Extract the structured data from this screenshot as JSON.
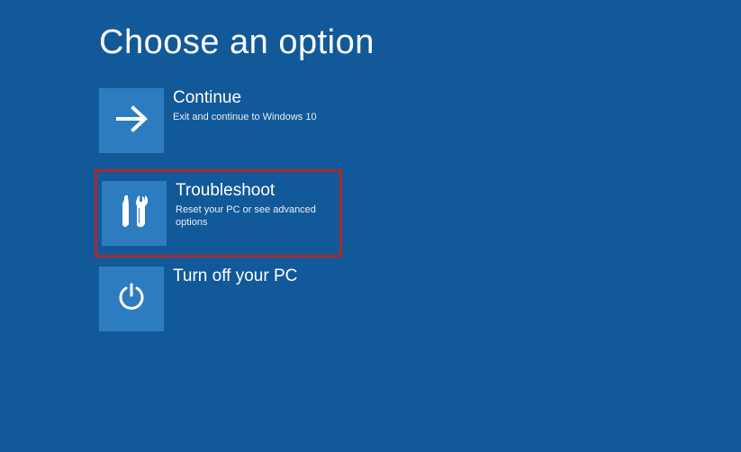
{
  "title": "Choose an option",
  "options": {
    "continue": {
      "title": "Continue",
      "subtitle": "Exit and continue to Windows 10"
    },
    "troubleshoot": {
      "title": "Troubleshoot",
      "subtitle": "Reset your PC or see advanced options"
    },
    "turnoff": {
      "title": "Turn off your PC"
    }
  },
  "highlight_color": "#a82a2a",
  "accent_color": "#2e7cc0",
  "background_color": "#12599a"
}
